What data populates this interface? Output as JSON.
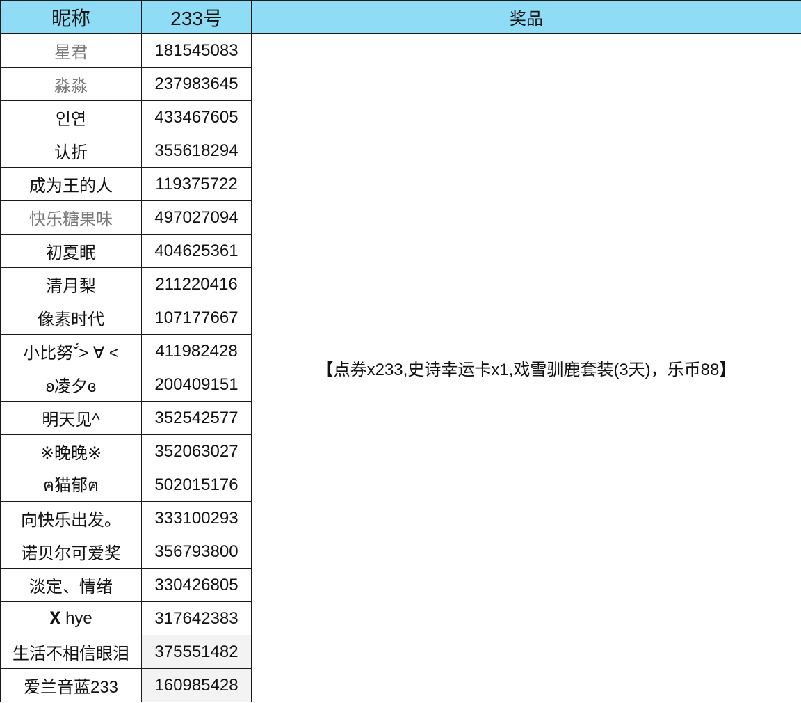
{
  "header": {
    "nickname_label": "昵称",
    "id_label": "233号",
    "prize_label": "奖品"
  },
  "rows": [
    {
      "nickname": "星君",
      "id": "181545083",
      "muted": true
    },
    {
      "nickname": "淼淼",
      "id": "237983645",
      "muted": true
    },
    {
      "nickname": "인연",
      "id": "433467605"
    },
    {
      "nickname": "认折",
      "id": "355618294"
    },
    {
      "nickname": "成为王的人",
      "id": "119375722"
    },
    {
      "nickname": "快乐糖果味",
      "id": "497027094",
      "muted": true
    },
    {
      "nickname": "初夏眠",
      "id": "404625361"
    },
    {
      "nickname": "清月梨",
      "id": "211220416"
    },
    {
      "nickname": "像素时代",
      "id": "107177667"
    },
    {
      "nickname": "小比努ˇ́> ∀ <",
      "id": "411982428"
    },
    {
      "nickname": "ʚ凌夕ɞ",
      "id": "200409151"
    },
    {
      "nickname": "明天见^",
      "id": "352542577"
    },
    {
      "nickname": "※晚晚※",
      "id": "352063027"
    },
    {
      "nickname": "ฅ猫郁ฅ",
      "id": "502015176"
    },
    {
      "nickname": "向快乐出发。",
      "id": "333100293"
    },
    {
      "nickname": "诺贝尔可爱奖",
      "id": "356793800"
    },
    {
      "nickname": "淡定、情绪",
      "id": "330426805"
    },
    {
      "nickname": "𝐗 hye",
      "id": "317642383"
    },
    {
      "nickname": "生活不相信眼泪",
      "id": "375551482",
      "shaded": true
    },
    {
      "nickname": "爱兰音蓝233",
      "id": "160985428",
      "shaded": true
    }
  ],
  "prize_text": "【点券x233,史诗幸运卡x1,戏雪驯鹿套装(3天)，乐币88】"
}
